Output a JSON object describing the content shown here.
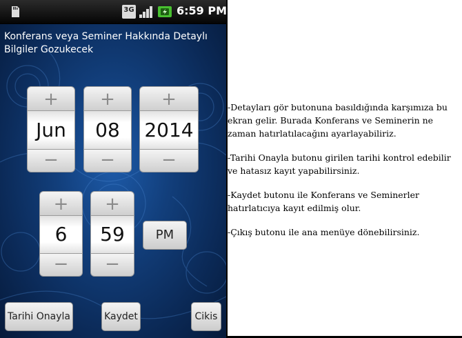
{
  "status_bar": {
    "network_label": "3G",
    "time": "6:59 PM"
  },
  "screen": {
    "title": "Konferans veya Seminer Hakkında Detaylı Bilgiler Gozukecek"
  },
  "date_picker": {
    "increment_symbol": "+",
    "decrement_symbol": "−",
    "month": "Jun",
    "day": "08",
    "year": "2014"
  },
  "time_picker": {
    "increment_symbol": "+",
    "decrement_symbol": "−",
    "hour": "6",
    "minute": "59",
    "ampm": "PM"
  },
  "buttons": {
    "confirm_date": "Tarihi Onayla",
    "save": "Kaydet",
    "exit": "Cikis"
  },
  "notes": [
    "-Detayları gör butonuna basıldığında karşımıza bu ekran gelir. Burada Konferans ve Seminerin ne zaman hatırlatılacağını ayarlayabiliriz.",
    "-Tarihi Onayla butonu girilen tarihi kontrol edebilir ve hatasız kayıt yapabilirsiniz.",
    "-Kaydet butonu ile Konferans ve Seminerler hatırlatıcıya kayıt edilmiş olur.",
    "-Çıkış butonu ile ana menüye dönebilirsiniz."
  ],
  "colors": {
    "status_bar": "#0a0a0a",
    "background": "#123f7c",
    "battery": "#48c030"
  }
}
